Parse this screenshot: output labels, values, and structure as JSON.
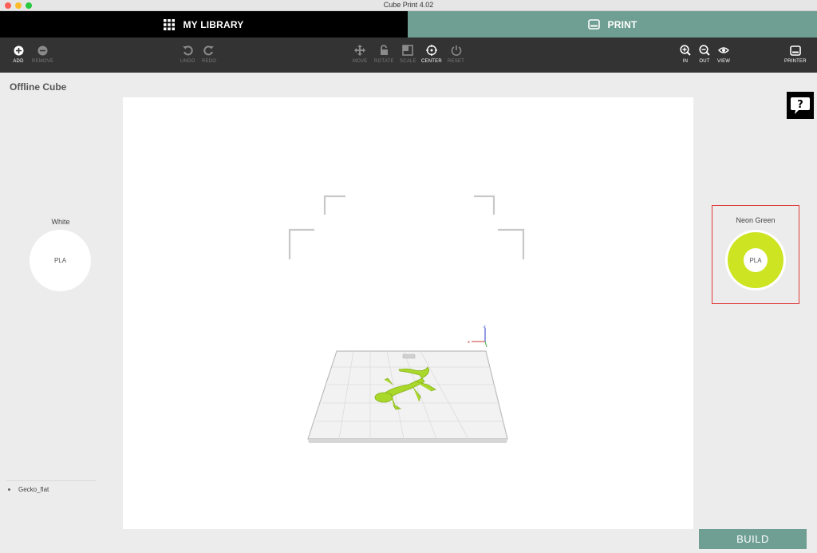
{
  "window": {
    "title": "Cube Print 4.02"
  },
  "tabs": {
    "library": "MY LIBRARY",
    "print": "PRINT"
  },
  "toolbar": {
    "add": "ADD",
    "remove": "REMOVE",
    "undo": "UNDO",
    "redo": "REDO",
    "move": "MOVE",
    "rotate": "ROTATE",
    "scale": "SCALE",
    "center": "CENTER",
    "reset": "RESET",
    "zoom_in": "IN",
    "zoom_out": "OUT",
    "view": "VIEW",
    "printer": "PRINTER"
  },
  "left_panel": {
    "printer_name": "Offline Cube",
    "material": {
      "color_name": "White",
      "type": "PLA",
      "color": "#ffffff"
    },
    "models": [
      "Gecko_flat"
    ]
  },
  "right_panel": {
    "material": {
      "color_name": "Neon Green",
      "type": "PLA",
      "color": "#cde422"
    }
  },
  "actions": {
    "build": "BUILD"
  },
  "icons": [
    "grid-icon",
    "printer-icon",
    "plus-circle-icon",
    "minus-circle-icon",
    "undo-icon",
    "redo-icon",
    "move-icon",
    "rotate-icon",
    "scale-icon",
    "center-icon",
    "reset-icon",
    "zoom-in-icon",
    "zoom-out-icon",
    "eye-icon",
    "help-icon"
  ],
  "colors": {
    "accent": "#6f9f92",
    "toolbar": "#333333",
    "selection_border": "#e03a3a"
  }
}
